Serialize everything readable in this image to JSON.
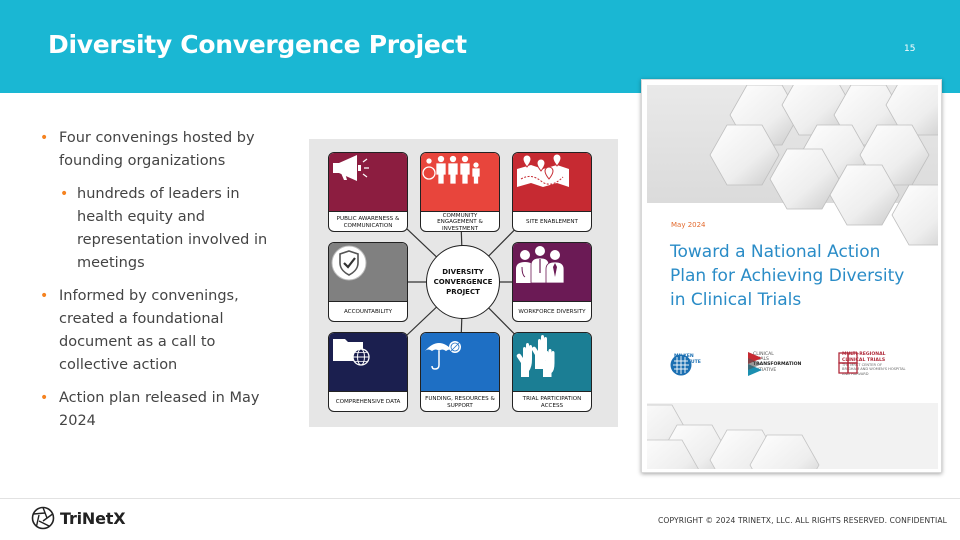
{
  "slide": {
    "title": "Diversity Convergence Project",
    "page_number": "15",
    "colors": {
      "header": "#1ab7d3",
      "bullet": "#f58220"
    }
  },
  "bullets": [
    {
      "text": "Four convenings hosted by founding organizations",
      "sub": [
        "hundreds of leaders in health equity and representation involved in meetings"
      ]
    },
    {
      "text": "Informed by convenings, created a foundational document as a call to collective action",
      "sub": []
    },
    {
      "text": "Action plan released in May 2024",
      "sub": []
    }
  ],
  "diagram": {
    "center": [
      "DIVERSITY",
      "CONVERGENCE",
      "PROJECT"
    ],
    "tiles": [
      {
        "label": "PUBLIC AWARENESS & COMMUNICATION",
        "icon": "megaphone-icon",
        "color": "#8c1d40"
      },
      {
        "label": "COMMUNITY ENGAGEMENT & INVESTMENT",
        "icon": "community-people-icon",
        "color": "#e8453c"
      },
      {
        "label": "SITE ENABLEMENT",
        "icon": "map-pins-icon",
        "color": "#c62a32"
      },
      {
        "label": "ACCOUNTABILITY",
        "icon": "shield-check-icon",
        "color": "#808080"
      },
      {
        "label": "WORKFORCE DIVERSITY",
        "icon": "workforce-icon",
        "color": "#6b1a55"
      },
      {
        "label": "COMPREHENSIVE DATA",
        "icon": "folder-globe-icon",
        "color": "#1b1f4f"
      },
      {
        "label": "FUNDING, RESOURCES & SUPPORT",
        "icon": "umbrella-icon",
        "color": "#1e6fc4"
      },
      {
        "label": "TRIAL PARTICIPATION ACCESS",
        "icon": "raised-hands-icon",
        "color": "#1b7e94"
      }
    ]
  },
  "cover": {
    "date": "May 2024",
    "title": "Toward a National Action Plan for Achieving Diversity in Clinical Trials",
    "logos": [
      {
        "name": [
          "MILKEN",
          "INSTITUTE"
        ],
        "icon": "milken-logo-icon"
      },
      {
        "name": [
          "CLINICAL",
          "TRIALS",
          "TRANSFORMATION",
          "INITIATIVE"
        ],
        "icon": "ctti-logo-icon"
      },
      {
        "name": [
          "MULTI-REGIONAL",
          "CLINICAL TRIALS"
        ],
        "sub": [
          "THE MRCT CENTER OF",
          "BRIGHAM AND WOMEN'S HOSPITAL",
          "AND HARVARD"
        ],
        "icon": "mrct-logo-icon"
      }
    ]
  },
  "footer": {
    "brand": "TriNetX",
    "copyright": "COPYRIGHT © 2024 TRINETX, LLC. ALL RIGHTS RESERVED. CONFIDENTIAL"
  }
}
